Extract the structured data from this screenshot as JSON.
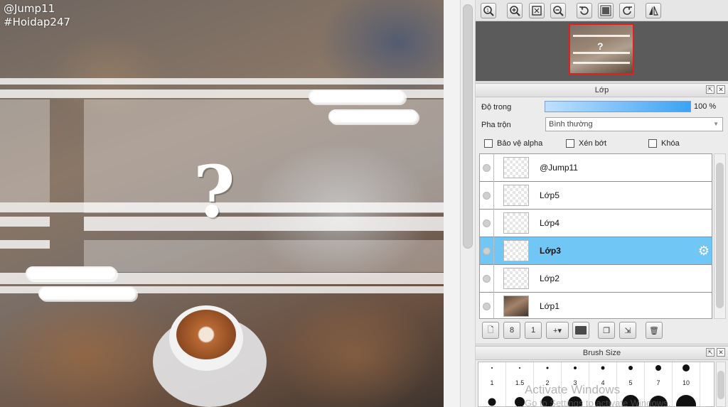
{
  "canvas": {
    "watermark_name": "@Jump11",
    "watermark_tag": "#Hoidap247",
    "question_mark": "?"
  },
  "toolbar": {
    "icons": [
      "zoom-actual-icon",
      "zoom-in-icon",
      "fit-window-icon",
      "zoom-out-icon",
      "rotate-left-icon",
      "reset-rotation-icon",
      "rotate-right-icon",
      "flip-horizontal-icon"
    ]
  },
  "layer_panel": {
    "title": "Lớp",
    "opacity_label": "Độ trong",
    "opacity_value": "100 %",
    "opacity_percent": 100,
    "blend_label": "Pha trộn",
    "blend_value": "Bình thường",
    "checkboxes": [
      {
        "label": "Bảo vệ alpha",
        "checked": false
      },
      {
        "label": "Xén bớt",
        "checked": false
      },
      {
        "label": "Khóa",
        "checked": false
      }
    ],
    "layers": [
      {
        "name": "@Jump11",
        "selected": false,
        "thumb": "transparent"
      },
      {
        "name": "Lớp5",
        "selected": false,
        "thumb": "transparent"
      },
      {
        "name": "Lớp4",
        "selected": false,
        "thumb": "transparent"
      },
      {
        "name": "Lớp3",
        "selected": true,
        "thumb": "transparent"
      },
      {
        "name": "Lớp2",
        "selected": false,
        "thumb": "transparent"
      },
      {
        "name": "Lớp1",
        "selected": false,
        "thumb": "photo"
      }
    ]
  },
  "brush_panel": {
    "title": "Brush Size",
    "sizes": [
      "1",
      "1.5",
      "2",
      "3",
      "4",
      "5",
      "7",
      "10"
    ]
  },
  "os_watermark": {
    "line1": "Activate Windows",
    "line2": "Go to Settings to activate Windows."
  },
  "colors": {
    "selection": "#70c7f5",
    "navigator_frame": "#e02020",
    "opacity_fill": "#3aa3f3"
  }
}
